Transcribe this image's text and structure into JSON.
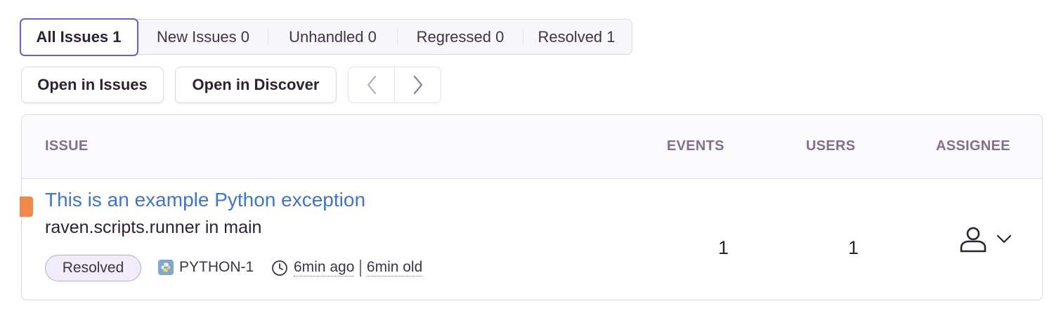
{
  "tabs": [
    {
      "label": "All Issues",
      "count": "1",
      "active": true
    },
    {
      "label": "New Issues",
      "count": "0"
    },
    {
      "label": "Unhandled",
      "count": "0"
    },
    {
      "label": "Regressed",
      "count": "0"
    },
    {
      "label": "Resolved",
      "count": "1"
    }
  ],
  "actions": {
    "open_issues": "Open in Issues",
    "open_discover": "Open in Discover"
  },
  "table": {
    "headers": {
      "issue": "ISSUE",
      "events": "EVENTS",
      "users": "USERS",
      "assignee": "ASSIGNEE"
    },
    "rows": [
      {
        "title": "This is an example Python exception",
        "culprit": "raven.scripts.runner in main",
        "status": "Resolved",
        "short_id": "PYTHON-1",
        "last_seen": "6min ago",
        "age": "6min old",
        "events": "1",
        "users": "1",
        "level_color": "#f1894a"
      }
    ]
  },
  "colors": {
    "accent": "#6c5fc7",
    "link": "#3d74db",
    "muted": "#80708f"
  }
}
